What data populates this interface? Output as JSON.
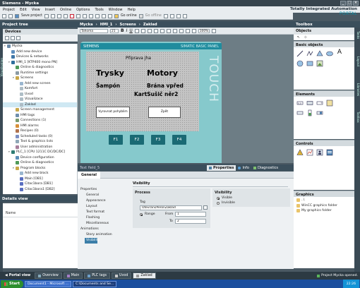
{
  "app": {
    "title": "Siemens - Mycka",
    "brand_line1": "Totally Integrated Automation",
    "brand_line2": "PORTAL"
  },
  "menu": [
    "Project",
    "Edit",
    "View",
    "Insert",
    "Online",
    "Options",
    "Tools",
    "Window",
    "Help"
  ],
  "toolbar": {
    "save_label": "Save project",
    "go_online": "Go online",
    "go_offline": "Go offline"
  },
  "project_tree": {
    "title": "Project tree",
    "tab": "Devices",
    "items": [
      {
        "label": "Mycka",
        "level": 0,
        "color": "#6b8aa8"
      },
      {
        "label": "Add new device",
        "level": 1,
        "color": "#5e8fbf"
      },
      {
        "label": "Devices & networks",
        "level": 1,
        "color": "#3f77a8"
      },
      {
        "label": "HMI_1 [KTP400 mono PN]",
        "level": 1,
        "color": "#2f6e9c"
      },
      {
        "label": "Online & diagnostics",
        "level": 2,
        "color": "#4f9a59"
      },
      {
        "label": "Runtime settings",
        "level": 2,
        "color": "#8b9ba5"
      },
      {
        "label": "Screens",
        "level": 2,
        "color": "#c9a84a"
      },
      {
        "label": "Add new screen",
        "level": 3,
        "color": "#9ab6cf"
      },
      {
        "label": "Komfort",
        "level": 3,
        "color": "#aebdc6"
      },
      {
        "label": "Uvod",
        "level": 3,
        "color": "#aebdc6"
      },
      {
        "label": "Vizualizace",
        "level": 3,
        "color": "#aebdc6"
      },
      {
        "label": "Zaklad",
        "level": 3,
        "color": "#aebdc6",
        "selected": true
      },
      {
        "label": "Screen management",
        "level": 2,
        "color": "#c9a84a"
      },
      {
        "label": "HMI tags",
        "level": 2,
        "color": "#6f8fad"
      },
      {
        "label": "Connections (1)",
        "level": 2,
        "color": "#7a9b6f"
      },
      {
        "label": "HMI alarms",
        "level": 2,
        "color": "#d8903a"
      },
      {
        "label": "Recipes (0)",
        "level": 2,
        "color": "#b0734f"
      },
      {
        "label": "Scheduled tasks (0)",
        "level": 2,
        "color": "#7c8fc4"
      },
      {
        "label": "Text & graphics lists",
        "level": 2,
        "color": "#8fa7b7"
      },
      {
        "label": "User administration",
        "level": 2,
        "color": "#a77e9b"
      },
      {
        "label": "PLC_1 [CPU 1211C DC/DC/DC]",
        "level": 1,
        "color": "#2e7d74"
      },
      {
        "label": "Device configuration",
        "level": 2,
        "color": "#5c8fb8"
      },
      {
        "label": "Online & diagnostics",
        "level": 2,
        "color": "#4f9a59"
      },
      {
        "label": "Program blocks",
        "level": 2,
        "color": "#c9a84a"
      },
      {
        "label": "Add new block",
        "level": 3,
        "color": "#9ab6cf"
      },
      {
        "label": "Main [OB1]",
        "level": 3,
        "color": "#5a6fc0"
      },
      {
        "label": "Citac1bora [DB1]",
        "level": 3,
        "color": "#5a6fc0"
      },
      {
        "label": "Citac1bora1 [DB2]",
        "level": 3,
        "color": "#5a6fc0"
      }
    ]
  },
  "details_view": {
    "title": "Details view",
    "column": "Name"
  },
  "breadcrumb": [
    "Mycka",
    "HMI_1",
    "Screens",
    "Zaklad"
  ],
  "editor_toolbar": {
    "font": "Tahoma",
    "font_size": "21",
    "zoom": "100%"
  },
  "hmi_panel": {
    "brand": "SIEMENS",
    "model": "SIMATIC BASIC PANEL",
    "touch_label": "TOUCH",
    "screen": {
      "header": "Příprava jha",
      "labels": [
        "Trysky",
        "Motory",
        "Šampón",
        "Brána vpřed",
        "KartSušič něr2"
      ],
      "buttons": [
        "Vyrovnat pohyblim",
        "Zpět"
      ]
    },
    "function_keys": [
      "F1",
      "F2",
      "F3",
      "F4"
    ]
  },
  "properties": {
    "object_title": "Text field_5",
    "tabs": [
      {
        "label": "Properties",
        "active": true
      },
      {
        "label": "Info",
        "active": false
      },
      {
        "label": "Diagnostics",
        "active": false
      }
    ],
    "general_tab": "General",
    "nav": [
      {
        "label": "Properties",
        "indent": 0
      },
      {
        "label": "General",
        "indent": 1
      },
      {
        "label": "Appearance",
        "indent": 1
      },
      {
        "label": "Layout",
        "indent": 1
      },
      {
        "label": "Text format",
        "indent": 1
      },
      {
        "label": "Flashing",
        "indent": 1
      },
      {
        "label": "Miscellaneous",
        "indent": 1
      },
      {
        "label": "Animations",
        "indent": 0
      },
      {
        "label": "Story animation",
        "indent": 1
      },
      {
        "label": "Visibility",
        "indent": 1,
        "selected": true
      }
    ],
    "visibility": {
      "section_title": "Visibility",
      "process_title": "Process",
      "tag_label": "Tag",
      "tag_value": "Otevrani/PeronZaklad",
      "range_label": "Range",
      "from_label": "From",
      "from_value": "1",
      "to_label": "To",
      "to_value": "2",
      "vis_box_title": "Visibility",
      "visible_label": "Visible",
      "invisible_label": "Invisible"
    }
  },
  "toolbox": {
    "title": "Toolbox",
    "objects_label": "Objects",
    "basic_objects": "Basic objects",
    "elements": "Elements",
    "controls": "Controls",
    "graphics": "Graphics",
    "graphics_items": [
      "..\\",
      "WinCC graphics folder",
      "My graphics folder"
    ]
  },
  "side_tabs": [
    "Tasks",
    "Layout",
    "Libraries",
    "Toolbox"
  ],
  "left_side_tab": "Visualisation",
  "portal_bar": {
    "portal_view": "Portal view",
    "tabs": [
      {
        "label": "Overview",
        "active": false
      },
      {
        "label": "Main",
        "active": false
      },
      {
        "label": "PLC tags",
        "active": false
      },
      {
        "label": "Uvod",
        "active": false
      },
      {
        "label": "Zaklad",
        "active": true
      }
    ],
    "status": "Project Mycka opened."
  },
  "taskbar": {
    "start": "Start",
    "tasks": [
      "Document1 - Microsoft ...",
      "C:\\Documents and Se..."
    ],
    "clock": "22:26"
  }
}
